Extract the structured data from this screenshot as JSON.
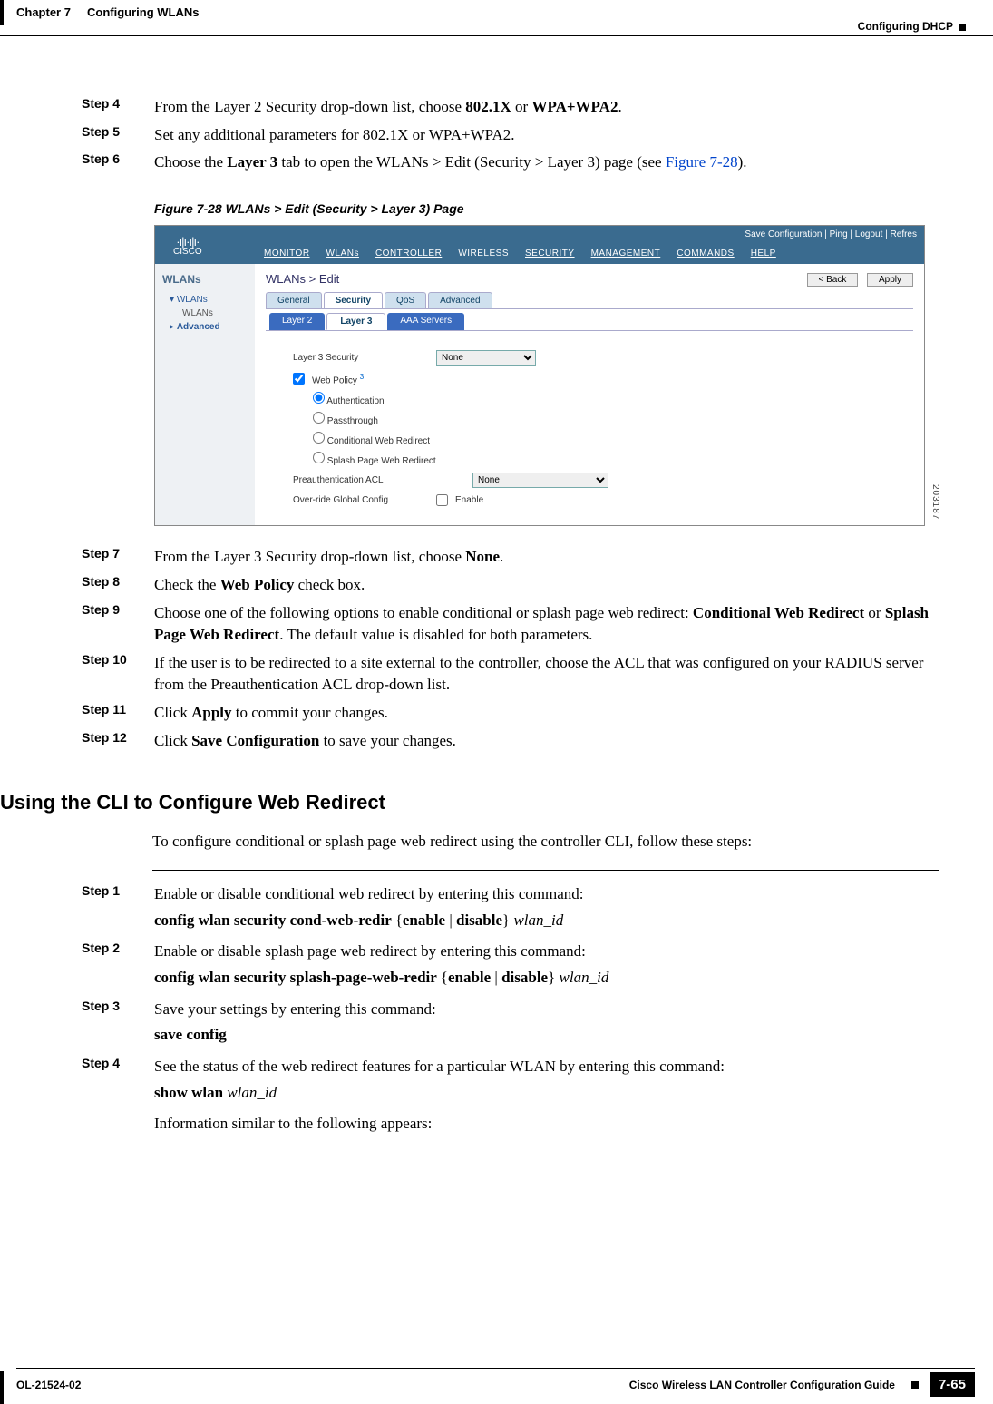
{
  "header": {
    "left_chapter": "Chapter 7",
    "left_title": "Configuring WLANs",
    "right": "Configuring DHCP"
  },
  "steps_a": {
    "s4": {
      "label": "Step 4",
      "text_a": "From the Layer 2 Security drop-down list, choose ",
      "b1": "802.1X",
      "mid": " or ",
      "b2": "WPA+WPA2",
      "end": "."
    },
    "s5": {
      "label": "Step 5",
      "text": "Set any additional parameters for 802.1X or WPA+WPA2."
    },
    "s6": {
      "label": "Step 6",
      "text_a": "Choose the ",
      "b1": "Layer 3",
      "text_b": " tab to open the WLANs > Edit (Security > Layer 3) page (see ",
      "link": "Figure 7-28",
      "end": ")."
    }
  },
  "figure": {
    "caption": "Figure 7-28   WLANs > Edit (Security > Layer 3) Page",
    "top_right": "Save Configuration   |   Ping   |   Logout   |  Refres",
    "nav": {
      "monitor": "MONITOR",
      "wlans": "WLANs",
      "controller": "CONTROLLER",
      "wireless": "WIRELESS",
      "security": "SECURITY",
      "management": "MANAGEMENT",
      "commands": "COMMANDS",
      "help": "HELP"
    },
    "cisco": "CISCO",
    "side": {
      "title": "WLANs",
      "item1": "WLANs",
      "item1a": "WLANs",
      "item2": "Advanced"
    },
    "breadcrumb": "WLANs > Edit",
    "btn_back": "< Back",
    "btn_apply": "Apply",
    "tabs": {
      "general": "General",
      "security": "Security",
      "qos": "QoS",
      "advanced": "Advanced"
    },
    "subtabs": {
      "l2": "Layer 2",
      "l3": "Layer 3",
      "aaa": "AAA Servers"
    },
    "form": {
      "l3sec_label": "Layer 3 Security",
      "l3sec_value": "None",
      "webpolicy": "Web Policy",
      "webpolicy_sup": "3",
      "auth": "Authentication",
      "pass": "Passthrough",
      "cond": "Conditional Web Redirect",
      "splash": "Splash Page Web Redirect",
      "preauth_label": "Preauthentication ACL",
      "preauth_value": "None",
      "override_label": "Over-ride Global Config",
      "override_cb": "Enable"
    },
    "figno": "203187"
  },
  "steps_b": {
    "s7": {
      "label": "Step 7",
      "text_a": "From the Layer 3 Security drop-down list, choose ",
      "b1": "None",
      "end": "."
    },
    "s8": {
      "label": "Step 8",
      "text_a": "Check the ",
      "b1": "Web Policy",
      "end": " check box."
    },
    "s9": {
      "label": "Step 9",
      "text_a": "Choose one of the following options to enable conditional or splash page web redirect: ",
      "b1": "Conditional Web Redirect",
      "mid": " or ",
      "b2": "Splash Page Web Redirect",
      "end": ". The default value is disabled for both parameters."
    },
    "s10": {
      "label": "Step 10",
      "text": "If the user is to be redirected to a site external to the controller, choose the ACL that was configured on your RADIUS server from the Preauthentication ACL drop-down list."
    },
    "s11": {
      "label": "Step 11",
      "text_a": "Click ",
      "b1": "Apply",
      "end": " to commit your changes."
    },
    "s12": {
      "label": "Step 12",
      "text_a": "Click ",
      "b1": "Save Configuration",
      "end": " to save your changes."
    }
  },
  "cli": {
    "heading": "Using the CLI to Configure Web Redirect",
    "intro": "To configure conditional or splash page web redirect using the controller CLI, follow these steps:",
    "s1": {
      "label": "Step 1",
      "text": "Enable or disable conditional web redirect by entering this command:",
      "cmd_a": "config wlan security cond-web-redir ",
      "brace_l": "{",
      "opt1": "enable",
      "pipe": " | ",
      "opt2": "disable",
      "brace_r": "}",
      "arg": " wlan_id"
    },
    "s2": {
      "label": "Step 2",
      "text": "Enable or disable splash page web redirect by entering this command:",
      "cmd_a": "config wlan security splash-page-web-redir ",
      "brace_l": "{",
      "opt1": "enable",
      "pipe": " | ",
      "opt2": "disable",
      "brace_r": "}",
      "arg": " wlan_id"
    },
    "s3": {
      "label": "Step 3",
      "text": "Save your settings by entering this command:",
      "cmd": "save config"
    },
    "s4": {
      "label": "Step 4",
      "text": "See the status of the web redirect features for a particular WLAN by entering this command:",
      "cmd_a": "show wlan ",
      "arg": "wlan_id",
      "text2": "Information similar to the following appears:"
    }
  },
  "footer": {
    "left": "OL-21524-02",
    "guide": "Cisco Wireless LAN Controller Configuration Guide",
    "page": "7-65"
  }
}
